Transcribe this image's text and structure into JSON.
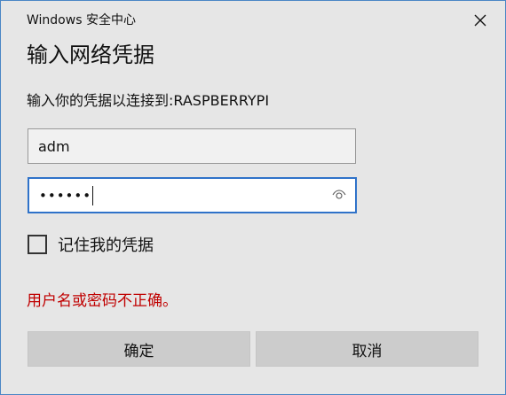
{
  "window": {
    "app_title": "Windows 安全中心",
    "close_icon": "close-icon"
  },
  "dialog": {
    "title": "输入网络凭据",
    "prompt": "输入你的凭据以连接到:RASPBERRYPI"
  },
  "fields": {
    "username_value": "adm",
    "password_value": "••••••",
    "reveal_icon": "eye-icon"
  },
  "remember": {
    "label": "记住我的凭据",
    "checked": false
  },
  "error": {
    "message": "用户名或密码不正确。",
    "color": "#c00000"
  },
  "buttons": {
    "ok_label": "确定",
    "cancel_label": "取消"
  },
  "colors": {
    "accent": "#2f72c9",
    "dialog_background": "#e6e6e6"
  }
}
